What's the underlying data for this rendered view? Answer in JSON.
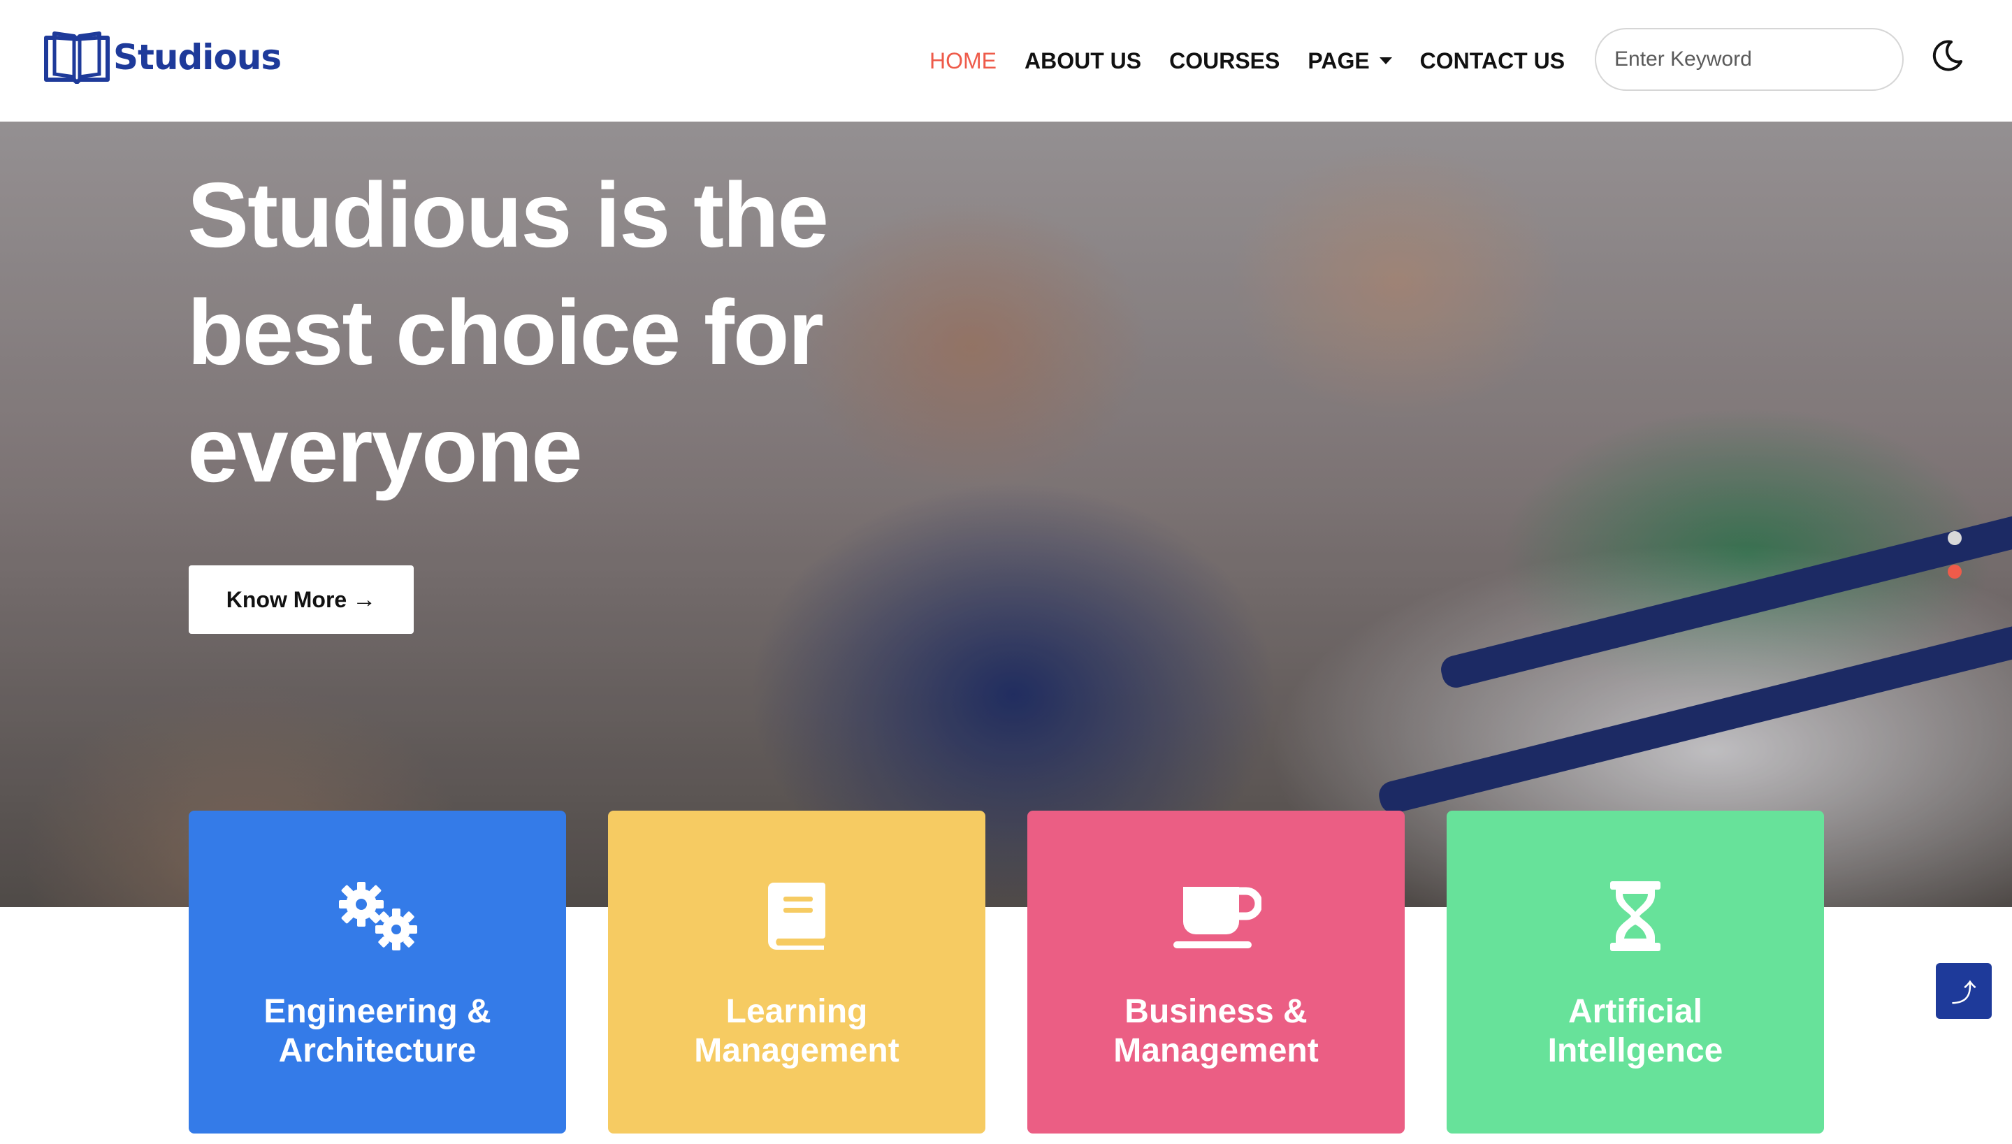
{
  "brand": {
    "name": "Studious",
    "color": "#1e3a9a"
  },
  "nav": {
    "items": [
      {
        "label": "HOME",
        "active": true
      },
      {
        "label": "ABOUT US",
        "active": false
      },
      {
        "label": "COURSES",
        "active": false
      },
      {
        "label": "PAGE",
        "active": false,
        "dropdown": true
      },
      {
        "label": "CONTACT US",
        "active": false
      }
    ],
    "active_color": "#ee5b4a"
  },
  "search": {
    "placeholder": "Enter Keyword",
    "value": "",
    "icon": "search-icon"
  },
  "theme_toggle": {
    "icon": "moon-icon"
  },
  "hero": {
    "title": "Studious is the best choice for everyone",
    "button_label": "Know More",
    "button_icon": "arrow-right-icon",
    "slider_dots": 2,
    "active_dot": 2
  },
  "cards": [
    {
      "title": "Engineering & Architecture",
      "icon": "gears-icon",
      "color": "#347be8"
    },
    {
      "title": "Learning Management",
      "icon": "book-icon",
      "color": "#f6cb62"
    },
    {
      "title": "Business & Management",
      "icon": "coffee-cup-icon",
      "color": "#eb5e84"
    },
    {
      "title": "Artificial Intellgence",
      "icon": "hourglass-icon",
      "color": "#67e29a"
    }
  ],
  "scroll_top": {
    "icon": "arrow-up-icon",
    "glyph": "⤴"
  }
}
